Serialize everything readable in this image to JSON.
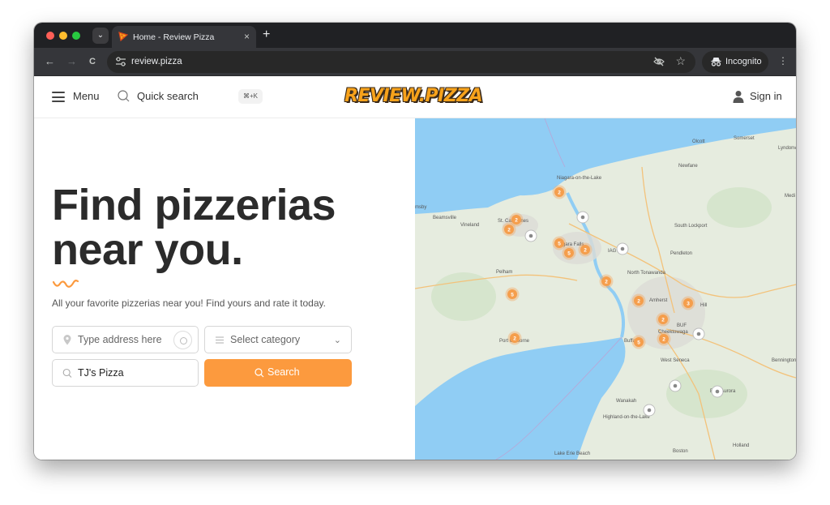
{
  "browser": {
    "tab_title": "Home - Review Pizza",
    "tab_close": "×",
    "new_tab": "+",
    "url": "review.pizza",
    "incognito_label": "Incognito",
    "nav": {
      "back": "←",
      "forward": "→",
      "reload": "C",
      "star": "☆",
      "kebab": "⋮",
      "tab_search": "⌄"
    }
  },
  "header": {
    "menu_label": "Menu",
    "quick_search_label": "Quick search",
    "shortcut": "⌘+K",
    "logo_text": "REVIEW.PIZZA",
    "signin_label": "Sign in"
  },
  "hero": {
    "title_line1": "Find pizzerias",
    "title_line2": "near you.",
    "subtitle": "All your favorite pizzerias near you! Find yours and rate it today.",
    "address_placeholder": "Type address here",
    "category_placeholder": "Select category",
    "keyword_value": "TJ's Pizza",
    "search_button": "Search"
  },
  "map": {
    "place_labels": [
      "Olcott",
      "Somerset",
      "Lyndonv",
      "Newfane",
      "Niagara-on-the-Lake",
      "Beamsville",
      "Vineland",
      "St. Catharines",
      "Niagara Falls",
      "South Lockport",
      "Pendleton",
      "North Tonawanda",
      "Pelham",
      "Amherst",
      "Hill",
      "Cheektowaga",
      "Port Colborne",
      "Buffalo",
      "West Seneca",
      "East Aurora",
      "Wanakah",
      "Highland-on-the-Lake",
      "Lake Erie Beach",
      "Boston",
      "Holland",
      "Bennington",
      "Medi",
      "msby",
      "BUF",
      "IAG"
    ],
    "cluster_counts": [
      "2",
      "2",
      "2",
      "5",
      "5",
      "2",
      "2",
      "5",
      "2",
      "2",
      "3",
      "2",
      "5",
      "2"
    ],
    "colors": {
      "water": "#90cdf4",
      "land": "#e8eee3",
      "cluster": "#f59e4c",
      "pin": "#ffffff"
    }
  },
  "colors": {
    "accent": "#fc9a3e",
    "title": "#2b2b2b"
  }
}
